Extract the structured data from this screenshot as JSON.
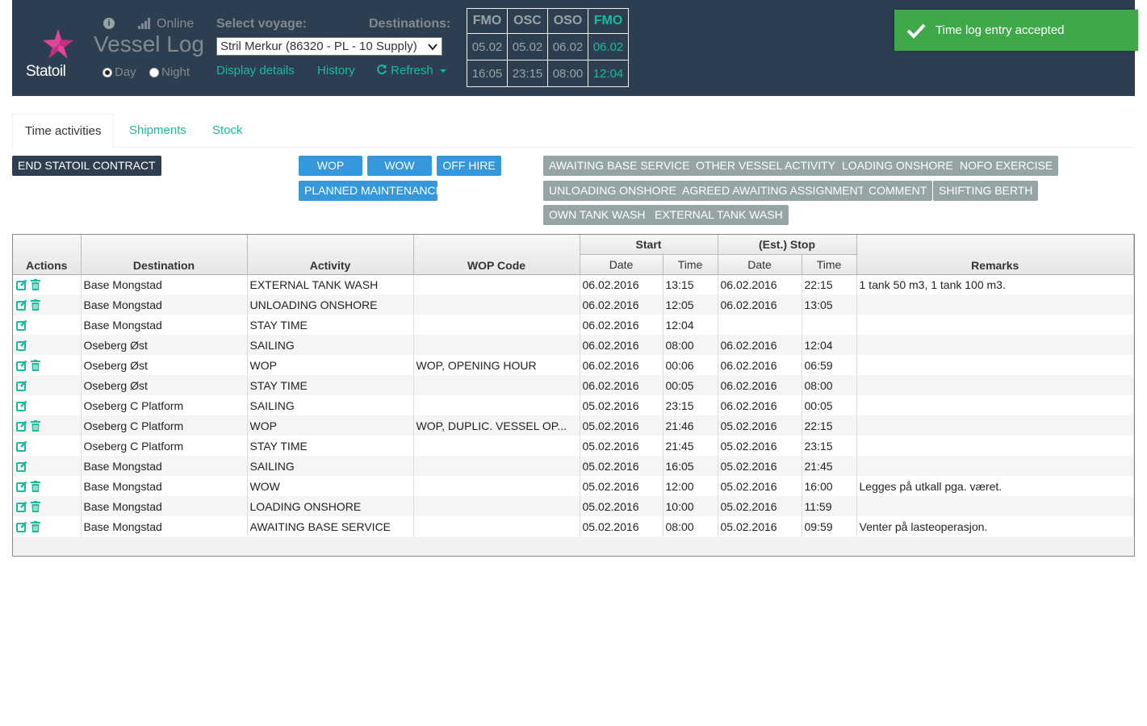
{
  "header": {
    "logo_text": "Statoil",
    "online_label": "Online",
    "app_title": "Vessel Log",
    "shift_options": [
      "Day",
      "Night"
    ],
    "shift_selected": "Day",
    "select_voyage_label": "Select voyage:",
    "destinations_label": "Destinations:",
    "voyage_value": "Stril Merkur (86320 - PL - 10 Supply)",
    "links": {
      "details": "Display details",
      "history": "History",
      "refresh": "Refresh"
    },
    "destinations": [
      {
        "code": "FMO",
        "date": "05.02",
        "time": "16:05"
      },
      {
        "code": "OSC",
        "date": "05.02",
        "time": "23:15"
      },
      {
        "code": "OSO",
        "date": "06.02",
        "time": "08:00"
      },
      {
        "code": "FMO",
        "date": "06.02",
        "time": "12:04"
      }
    ]
  },
  "toast": {
    "message": "Time log entry accepted"
  },
  "tabs": [
    "Time activities",
    "Shipments",
    "Stock"
  ],
  "buttons": {
    "end_contract": "END STATOIL CONTRACT",
    "blue": [
      "WOP",
      "WOW",
      "OFF HIRE",
      "PLANNED MAINTENANCE"
    ],
    "gray": [
      "AWAITING BASE SERVICE",
      "OTHER VESSEL ACTIVITY",
      "LOADING ONSHORE",
      "NOFO EXERCISE",
      "UNLOADING ONSHORE",
      "AGREED AWAITING ASSIGNMENT",
      "COMMENT",
      "SHIFTING BERTH",
      "OWN TANK WASH",
      "EXTERNAL TANK WASH"
    ]
  },
  "table": {
    "group_start": "Start",
    "group_stop": "(Est.) Stop",
    "columns": {
      "actions": "Actions",
      "destination": "Destination",
      "activity": "Activity",
      "wop": "WOP Code",
      "date": "Date",
      "time": "Time",
      "remarks": "Remarks"
    },
    "rows": [
      {
        "del": true,
        "destination": "Base Mongstad",
        "activity": "EXTERNAL TANK WASH",
        "wop": "",
        "start_date": "06.02.2016",
        "start_time": "13:15",
        "stop_date": "06.02.2016",
        "stop_time": "22:15",
        "remarks": "1 tank 50 m3, 1 tank 100 m3."
      },
      {
        "del": true,
        "destination": "Base Mongstad",
        "activity": "UNLOADING ONSHORE",
        "wop": "",
        "start_date": "06.02.2016",
        "start_time": "12:05",
        "stop_date": "06.02.2016",
        "stop_time": "13:05",
        "remarks": ""
      },
      {
        "del": false,
        "destination": "Base Mongstad",
        "activity": "STAY TIME",
        "wop": "",
        "start_date": "06.02.2016",
        "start_time": "12:04",
        "stop_date": "",
        "stop_time": "",
        "remarks": ""
      },
      {
        "del": false,
        "destination": "Oseberg Øst",
        "activity": "SAILING",
        "wop": "",
        "start_date": "06.02.2016",
        "start_time": "08:00",
        "stop_date": "06.02.2016",
        "stop_time": "12:04",
        "remarks": ""
      },
      {
        "del": true,
        "destination": "Oseberg Øst",
        "activity": "WOP",
        "wop": "WOP, OPENING HOUR",
        "start_date": "06.02.2016",
        "start_time": "00:06",
        "stop_date": "06.02.2016",
        "stop_time": "06:59",
        "remarks": ""
      },
      {
        "del": false,
        "destination": "Oseberg Øst",
        "activity": "STAY TIME",
        "wop": "",
        "start_date": "06.02.2016",
        "start_time": "00:05",
        "stop_date": "06.02.2016",
        "stop_time": "08:00",
        "remarks": ""
      },
      {
        "del": false,
        "destination": "Oseberg C Platform",
        "activity": "SAILING",
        "wop": "",
        "start_date": "05.02.2016",
        "start_time": "23:15",
        "stop_date": "06.02.2016",
        "stop_time": "00:05",
        "remarks": ""
      },
      {
        "del": true,
        "destination": "Oseberg C Platform",
        "activity": "WOP",
        "wop": "WOP, DUPLIC. VESSEL OP...",
        "start_date": "05.02.2016",
        "start_time": "21:46",
        "stop_date": "05.02.2016",
        "stop_time": "22:15",
        "remarks": ""
      },
      {
        "del": false,
        "destination": "Oseberg C Platform",
        "activity": "STAY TIME",
        "wop": "",
        "start_date": "05.02.2016",
        "start_time": "21:45",
        "stop_date": "05.02.2016",
        "stop_time": "23:15",
        "remarks": ""
      },
      {
        "del": false,
        "destination": "Base Mongstad",
        "activity": "SAILING",
        "wop": "",
        "start_date": "05.02.2016",
        "start_time": "16:05",
        "stop_date": "05.02.2016",
        "stop_time": "21:45",
        "remarks": ""
      },
      {
        "del": true,
        "destination": "Base Mongstad",
        "activity": "WOW",
        "wop": "",
        "start_date": "05.02.2016",
        "start_time": "12:00",
        "stop_date": "05.02.2016",
        "stop_time": "16:00",
        "remarks": "Legges på utkall pga. været."
      },
      {
        "del": true,
        "destination": "Base Mongstad",
        "activity": "LOADING ONSHORE",
        "wop": "",
        "start_date": "05.02.2016",
        "start_time": "10:00",
        "stop_date": "05.02.2016",
        "stop_time": "11:59",
        "remarks": ""
      },
      {
        "del": true,
        "destination": "Base Mongstad",
        "activity": "AWAITING BASE SERVICE",
        "wop": "",
        "start_date": "05.02.2016",
        "start_time": "08:00",
        "stop_date": "05.02.2016",
        "stop_time": "09:59",
        "remarks": "Venter på lasteoperasjon."
      }
    ]
  },
  "colors": {
    "navy": "#2c3e50",
    "teal": "#18bc9c",
    "blue": "#3498db",
    "gray": "#95a5a6",
    "success": "#3fa94a"
  }
}
